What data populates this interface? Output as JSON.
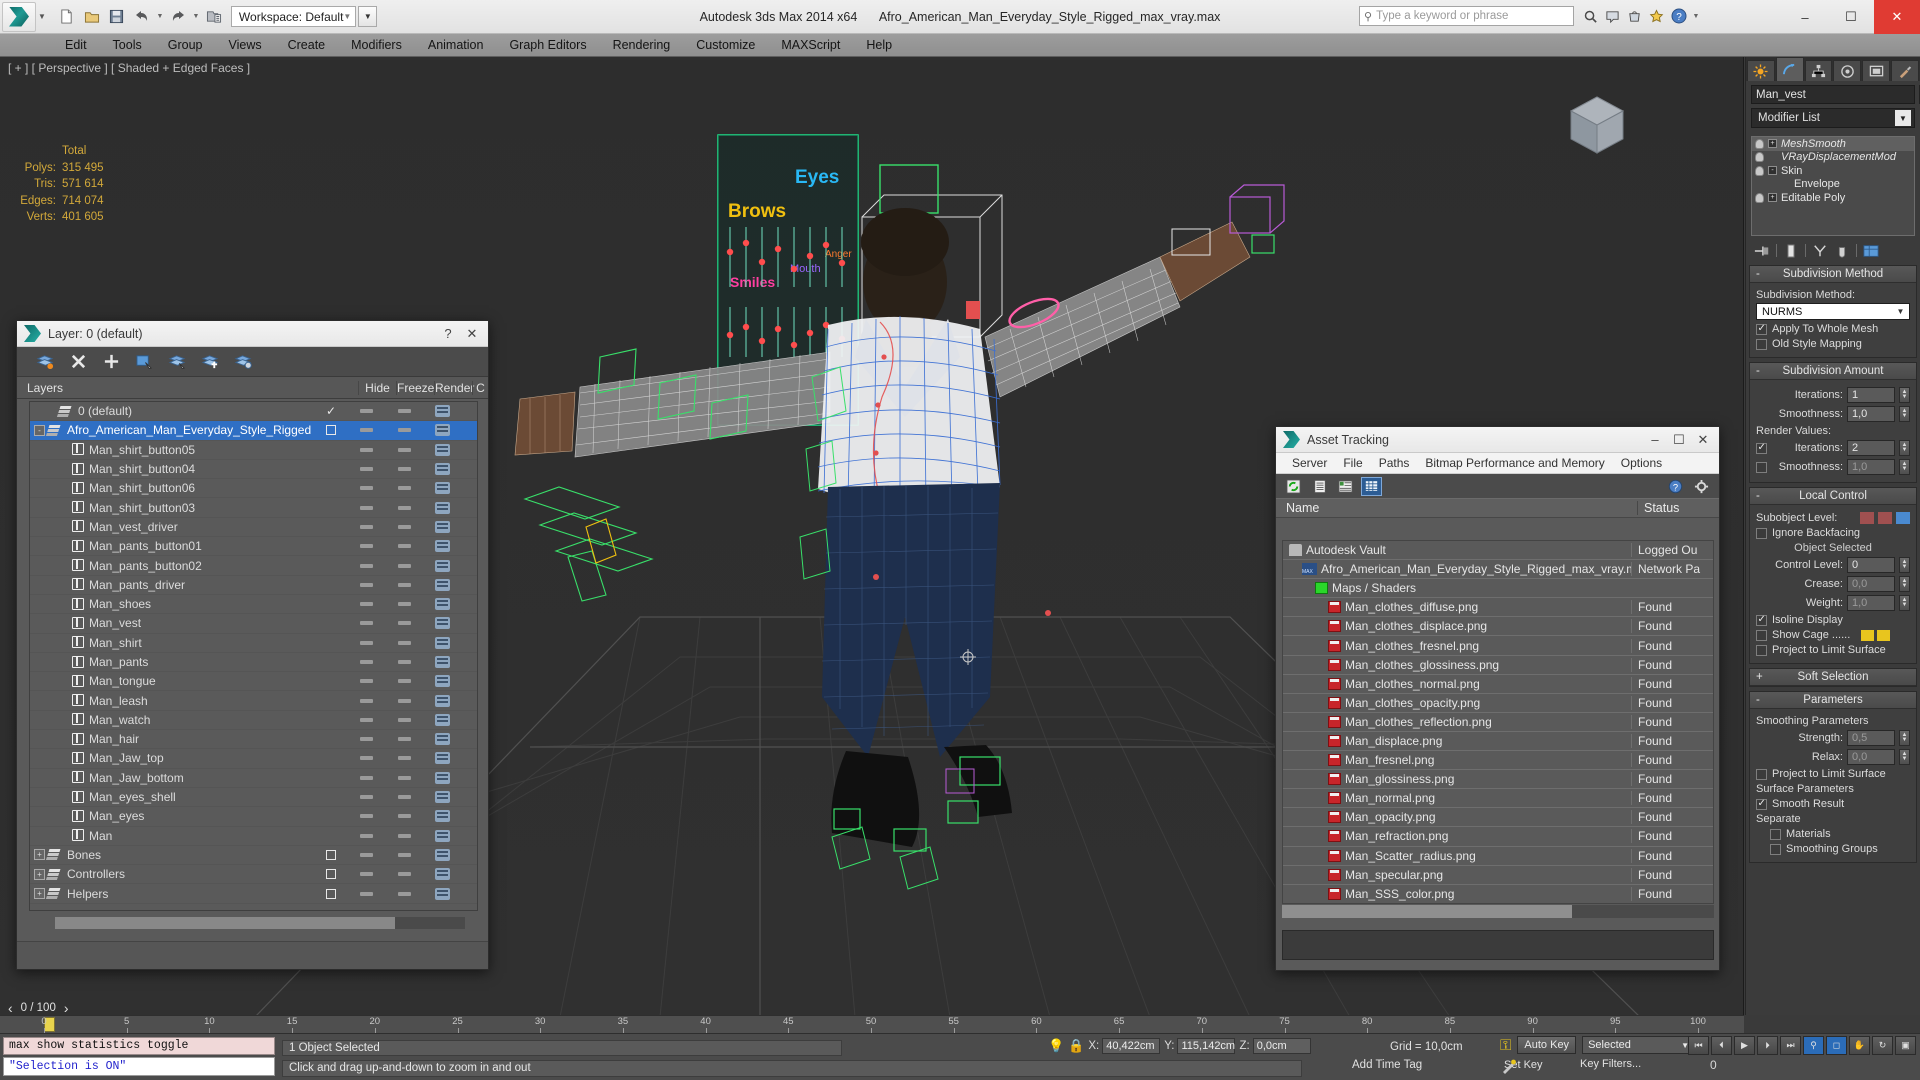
{
  "app": {
    "title": "Autodesk 3ds Max  2014 x64",
    "filename": "Afro_American_Man_Everyday_Style_Rigged_max_vray.max",
    "workspace_label": "Workspace: Default",
    "search_placeholder": "Type a keyword or phrase",
    "window_buttons": {
      "minimize": "–",
      "maximize": "☐",
      "close": "✕"
    }
  },
  "menubar": {
    "items": [
      "Edit",
      "Tools",
      "Group",
      "Views",
      "Create",
      "Modifiers",
      "Animation",
      "Graph Editors",
      "Rendering",
      "Customize",
      "MAXScript",
      "Help"
    ]
  },
  "viewport": {
    "label": "[ + ] [ Perspective ] [ Shaded + Edged Faces ]",
    "stats": {
      "header": "Total",
      "rows": [
        {
          "label": "Polys:",
          "value": "315 495"
        },
        {
          "label": "Tris:",
          "value": "571 614"
        },
        {
          "label": "Edges:",
          "value": "714 074"
        },
        {
          "label": "Verts:",
          "value": "401 605"
        }
      ]
    },
    "morph_labels": [
      "Brows",
      "Eyes",
      "Smiles",
      "Mouth",
      "Anger"
    ]
  },
  "layer_dialog": {
    "title": "Layer: 0 (default)",
    "help_button": "?",
    "close_button": "✕",
    "toolbar_icons": [
      "new-layer-icon",
      "delete-layer-icon",
      "add-layer-icon",
      "select-objects-in-layer-icon",
      "highlight-selected-objects-icon",
      "add-selection-to-layer-icon",
      "layer-properties-icon"
    ],
    "columns": [
      "Layers",
      "",
      "Hide",
      "Freeze",
      "Render",
      "C"
    ],
    "rows": [
      {
        "name": "0 (default)",
        "icon": "layer-stack-icon",
        "indent": 1,
        "selected": false,
        "expand": "",
        "check": "check"
      },
      {
        "name": "Afro_American_Man_Everyday_Style_Rigged",
        "icon": "layer-stack-icon",
        "indent": 0,
        "selected": true,
        "expand": "-",
        "check": "box"
      },
      {
        "name": "Man_shirt_button05",
        "icon": "object-cube-icon",
        "indent": 2,
        "selected": false,
        "expand": "",
        "check": ""
      },
      {
        "name": "Man_shirt_button04",
        "icon": "object-cube-icon",
        "indent": 2,
        "selected": false,
        "expand": "",
        "check": ""
      },
      {
        "name": "Man_shirt_button06",
        "icon": "object-cube-icon",
        "indent": 2,
        "selected": false,
        "expand": "",
        "check": ""
      },
      {
        "name": "Man_shirt_button03",
        "icon": "object-cube-icon",
        "indent": 2,
        "selected": false,
        "expand": "",
        "check": ""
      },
      {
        "name": "Man_vest_driver",
        "icon": "object-cube-icon",
        "indent": 2,
        "selected": false,
        "expand": "",
        "check": ""
      },
      {
        "name": "Man_pants_button01",
        "icon": "object-cube-icon",
        "indent": 2,
        "selected": false,
        "expand": "",
        "check": ""
      },
      {
        "name": "Man_pants_button02",
        "icon": "object-cube-icon",
        "indent": 2,
        "selected": false,
        "expand": "",
        "check": ""
      },
      {
        "name": "Man_pants_driver",
        "icon": "object-cube-icon",
        "indent": 2,
        "selected": false,
        "expand": "",
        "check": ""
      },
      {
        "name": "Man_shoes",
        "icon": "object-cube-icon",
        "indent": 2,
        "selected": false,
        "expand": "",
        "check": ""
      },
      {
        "name": "Man_vest",
        "icon": "object-cube-icon",
        "indent": 2,
        "selected": false,
        "expand": "",
        "check": ""
      },
      {
        "name": "Man_shirt",
        "icon": "object-cube-icon",
        "indent": 2,
        "selected": false,
        "expand": "",
        "check": ""
      },
      {
        "name": "Man_pants",
        "icon": "object-cube-icon",
        "indent": 2,
        "selected": false,
        "expand": "",
        "check": ""
      },
      {
        "name": "Man_tongue",
        "icon": "object-cube-icon",
        "indent": 2,
        "selected": false,
        "expand": "",
        "check": ""
      },
      {
        "name": "Man_leash",
        "icon": "object-cube-icon",
        "indent": 2,
        "selected": false,
        "expand": "",
        "check": ""
      },
      {
        "name": "Man_watch",
        "icon": "object-cube-icon",
        "indent": 2,
        "selected": false,
        "expand": "",
        "check": ""
      },
      {
        "name": "Man_hair",
        "icon": "object-cube-icon",
        "indent": 2,
        "selected": false,
        "expand": "",
        "check": ""
      },
      {
        "name": "Man_Jaw_top",
        "icon": "object-cube-icon",
        "indent": 2,
        "selected": false,
        "expand": "",
        "check": ""
      },
      {
        "name": "Man_Jaw_bottom",
        "icon": "object-cube-icon",
        "indent": 2,
        "selected": false,
        "expand": "",
        "check": ""
      },
      {
        "name": "Man_eyes_shell",
        "icon": "object-cube-icon",
        "indent": 2,
        "selected": false,
        "expand": "",
        "check": ""
      },
      {
        "name": "Man_eyes",
        "icon": "object-cube-icon",
        "indent": 2,
        "selected": false,
        "expand": "",
        "check": ""
      },
      {
        "name": "Man",
        "icon": "object-cube-icon",
        "indent": 2,
        "selected": false,
        "expand": "",
        "check": ""
      },
      {
        "name": "Bones",
        "icon": "layer-stack-icon",
        "indent": 0,
        "selected": false,
        "expand": "+",
        "check": "box"
      },
      {
        "name": "Controllers",
        "icon": "layer-stack-icon",
        "indent": 0,
        "selected": false,
        "expand": "+",
        "check": "box"
      },
      {
        "name": "Helpers",
        "icon": "layer-stack-icon",
        "indent": 0,
        "selected": false,
        "expand": "+",
        "check": "box"
      }
    ]
  },
  "asset_dialog": {
    "title": "Asset Tracking",
    "menu": [
      "Server",
      "File",
      "Paths",
      "Bitmap Performance and Memory",
      "Options"
    ],
    "toolbar_icons": [
      "refresh-icon",
      "list-view-icon",
      "detail-view-icon",
      "grid-view-icon",
      "help-icon",
      "settings-icon"
    ],
    "window_buttons": {
      "minimize": "–",
      "maximize": "☐",
      "close": "✕"
    },
    "columns": [
      "Name",
      "Status"
    ],
    "rows": [
      {
        "name": "Autodesk Vault",
        "status": "Logged Ou",
        "icon": "vault-icon",
        "indent": 0
      },
      {
        "name": "Afro_American_Man_Everyday_Style_Rigged_max_vray.max",
        "status": "Network Pa",
        "icon": "max-file-icon",
        "indent": 1
      },
      {
        "name": "Maps / Shaders",
        "status": "",
        "icon": "maps-shaders-icon",
        "indent": 2
      },
      {
        "name": "Man_clothes_diffuse.png",
        "status": "Found",
        "icon": "png-file-icon",
        "indent": 3
      },
      {
        "name": "Man_clothes_displace.png",
        "status": "Found",
        "icon": "png-file-icon",
        "indent": 3
      },
      {
        "name": "Man_clothes_fresnel.png",
        "status": "Found",
        "icon": "png-file-icon",
        "indent": 3
      },
      {
        "name": "Man_clothes_glossiness.png",
        "status": "Found",
        "icon": "png-file-icon",
        "indent": 3
      },
      {
        "name": "Man_clothes_normal.png",
        "status": "Found",
        "icon": "png-file-icon",
        "indent": 3
      },
      {
        "name": "Man_clothes_opacity.png",
        "status": "Found",
        "icon": "png-file-icon",
        "indent": 3
      },
      {
        "name": "Man_clothes_reflection.png",
        "status": "Found",
        "icon": "png-file-icon",
        "indent": 3
      },
      {
        "name": "Man_displace.png",
        "status": "Found",
        "icon": "png-file-icon",
        "indent": 3
      },
      {
        "name": "Man_fresnel.png",
        "status": "Found",
        "icon": "png-file-icon",
        "indent": 3
      },
      {
        "name": "Man_glossiness.png",
        "status": "Found",
        "icon": "png-file-icon",
        "indent": 3
      },
      {
        "name": "Man_normal.png",
        "status": "Found",
        "icon": "png-file-icon",
        "indent": 3
      },
      {
        "name": "Man_opacity.png",
        "status": "Found",
        "icon": "png-file-icon",
        "indent": 3
      },
      {
        "name": "Man_refraction.png",
        "status": "Found",
        "icon": "png-file-icon",
        "indent": 3
      },
      {
        "name": "Man_Scatter_radius.png",
        "status": "Found",
        "icon": "png-file-icon",
        "indent": 3
      },
      {
        "name": "Man_specular.png",
        "status": "Found",
        "icon": "png-file-icon",
        "indent": 3
      },
      {
        "name": "Man_SSS_color.png",
        "status": "Found",
        "icon": "png-file-icon",
        "indent": 3
      }
    ]
  },
  "command_panel": {
    "tabs": [
      "create-tab",
      "modify-tab",
      "hierarchy-tab",
      "motion-tab",
      "display-tab",
      "utilities-tab"
    ],
    "active_tab_index": 1,
    "object_name": "Man_vest",
    "modifier_list_label": "Modifier List",
    "modifier_stack": [
      {
        "label": "MeshSmooth",
        "expand": "+",
        "italic": true,
        "selected": true,
        "indent": 0
      },
      {
        "label": "VRayDisplacementMod",
        "expand": "",
        "italic": true,
        "selected": false,
        "indent": 1
      },
      {
        "label": "Skin",
        "expand": "-",
        "italic": false,
        "selected": false,
        "indent": 0
      },
      {
        "label": "Envelope",
        "expand": "",
        "italic": false,
        "selected": false,
        "indent": 2
      },
      {
        "label": "Editable Poly",
        "expand": "+",
        "italic": false,
        "selected": false,
        "indent": 0
      }
    ],
    "rollouts": [
      {
        "title": "Subdivision Method",
        "minus": "-",
        "fields": {
          "label": "Subdivision Method:",
          "value": "NURMS"
        },
        "checks": [
          {
            "label": "Apply To Whole Mesh",
            "on": true
          },
          {
            "label": "Old Style Mapping",
            "on": false
          }
        ]
      },
      {
        "title": "Subdivision Amount",
        "minus": "-",
        "spinners": [
          {
            "label": "Iterations:",
            "value": "1"
          },
          {
            "label": "Smoothness:",
            "value": "1,0"
          }
        ],
        "render_label": "Render Values:",
        "render_spinners": [
          {
            "label": "Iterations:",
            "value": "2",
            "on": true
          },
          {
            "label": "Smoothness:",
            "value": "1,0",
            "on": false
          }
        ]
      },
      {
        "title": "Local Control",
        "minus": "-",
        "subobject_label": "Subobject Level:",
        "checks": [
          {
            "label": "Ignore Backfacing",
            "on": false
          }
        ],
        "object_selected": "Object Selected",
        "control_level": {
          "label": "Control Level:",
          "value": "0"
        },
        "crease": {
          "label": "Crease:",
          "value": "0,0"
        },
        "weight": {
          "label": "Weight:",
          "value": "1,0"
        },
        "isoline": {
          "label": "Isoline Display",
          "on": true
        },
        "showcage": {
          "label": "Show Cage ......",
          "on": false
        }
      },
      {
        "title": "Soft Selection",
        "minus": "+"
      },
      {
        "title": "Parameters",
        "minus": "-",
        "smoothing_header": "Smoothing Parameters",
        "strength": {
          "label": "Strength:",
          "value": "0,5"
        },
        "relax": {
          "label": "Relax:",
          "value": "0,0"
        },
        "project": {
          "label": "Project to Limit Surface",
          "on": false
        },
        "surface_header": "Surface Parameters",
        "smooth_result": {
          "label": "Smooth Result",
          "on": true
        },
        "separate_header": "Separate",
        "materials": {
          "label": "Materials",
          "on": false
        },
        "smoothing_groups": {
          "label": "Smoothing Groups",
          "on": false
        }
      }
    ]
  },
  "timeline": {
    "ticks": [
      "0",
      "5",
      "10",
      "15",
      "20",
      "25",
      "30",
      "35",
      "40",
      "45",
      "50",
      "55",
      "60",
      "65",
      "70",
      "75",
      "80",
      "85",
      "90",
      "95",
      "100"
    ],
    "frame_display": "0 / 100",
    "prev_arrow": "‹",
    "next_arrow": "›"
  },
  "status_bar": {
    "listener_line1": "max show statistics toggle",
    "listener_line2": "\"Selection is ON\"",
    "prompt1": "1 Object Selected",
    "prompt2": "Click and drag up-and-down to zoom in and out",
    "coords": [
      {
        "key": "X:",
        "value": "40,422cm"
      },
      {
        "key": "Y:",
        "value": "115,142cm"
      },
      {
        "key": "Z:",
        "value": "0,0cm"
      }
    ],
    "grid": "Grid = 10,0cm",
    "auto_key": "Auto Key",
    "set_key": "Set Key",
    "selected_filter": "Selected",
    "key_filters": "Key Filters...",
    "add_time_tag": "Add Time Tag",
    "key_value": "0"
  },
  "colors": {
    "accent_blue": "#2f6fc4",
    "stats_yellow": "#d3a93a",
    "teal_logo": "#1e9b94",
    "close_red": "#e03b33"
  }
}
